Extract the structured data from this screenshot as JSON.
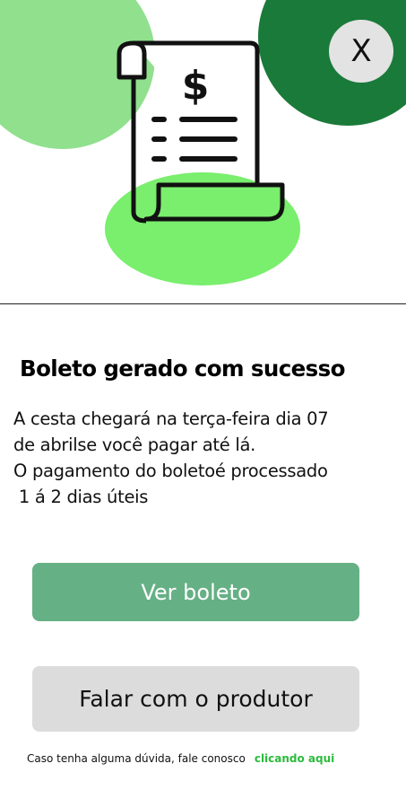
{
  "header": {
    "close_label": "X"
  },
  "receipt_icon": {
    "currency_symbol": "$"
  },
  "content": {
    "title": "Boleto gerado com sucesso",
    "message_lines": [
      "A cesta chegará na terça-feira dia 07",
      "de abrilse você pagar até lá.",
      "O pagamento do boletoé processado",
      " 1 á 2 dias úteis"
    ]
  },
  "actions": {
    "view_boleto_label": "Ver boleto",
    "contact_producer_label": "Falar com o produtor"
  },
  "footer": {
    "help_text": "Caso tenha alguma dúvida, fale conosco",
    "help_link": "clicando aqui"
  },
  "colors": {
    "light_green": "#90e08e",
    "dark_green": "#1a7a3a",
    "bright_green": "#7aee6d",
    "button_green": "#66b085",
    "link_green": "#2bbb3c",
    "button_gray": "#dcdcdc"
  }
}
